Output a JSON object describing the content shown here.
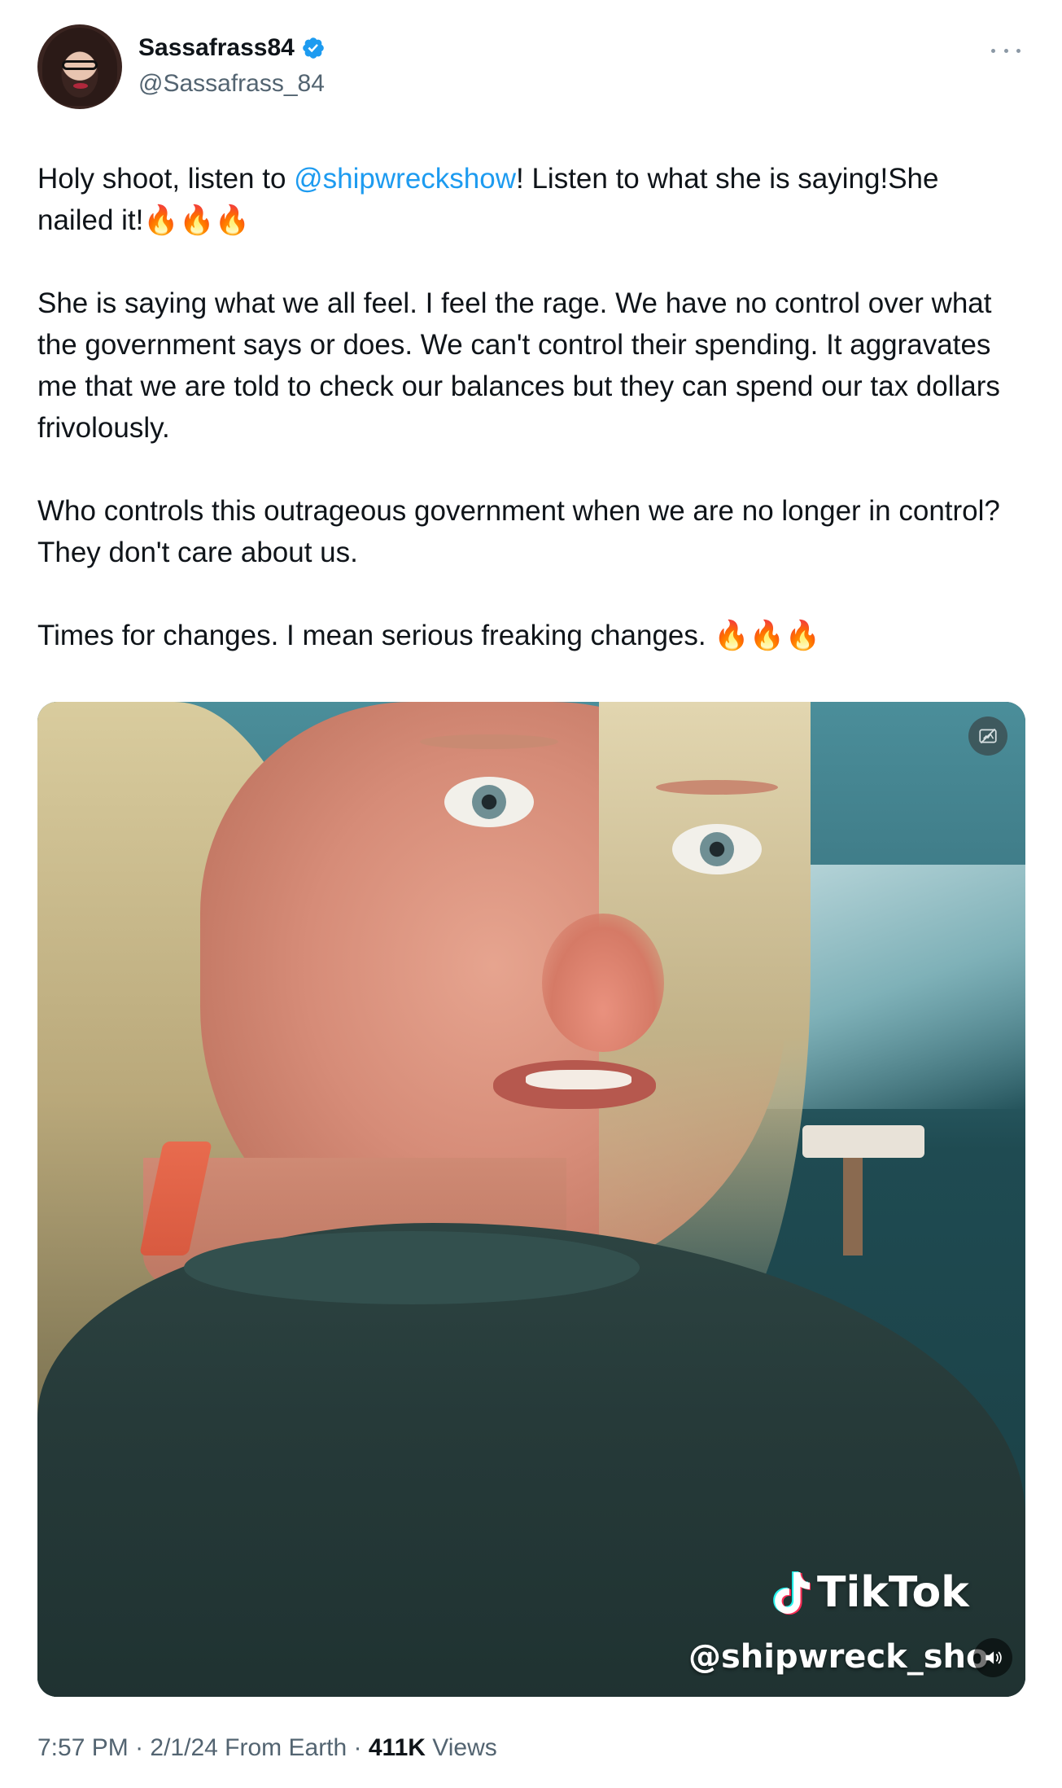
{
  "author": {
    "display_name": "Sassafrass84",
    "handle": "@Sassafrass_84",
    "verified": true
  },
  "tweet": {
    "paragraphs": [
      {
        "before": "Holy shoot, listen to ",
        "mention": "@shipwreckshow",
        "after": "! Listen to what she is saying!She nailed it!🔥🔥🔥"
      },
      {
        "text": "She is saying what we all feel. I feel the rage. We have no control over what the government says or does. We can't control their spending. It aggravates me that we are told to check our balances but they can spend our tax dollars frivolously."
      },
      {
        "text": "Who controls this outrageous government when we are no longer in control? They don't care about us."
      },
      {
        "text": "Times for changes. I mean serious freaking changes. 🔥🔥🔥"
      }
    ]
  },
  "media": {
    "watermark_brand": "TikTok",
    "watermark_user": "@shipwreck_show",
    "icons": [
      "sensitive-content-icon",
      "tiktok-logo-icon",
      "volume-icon"
    ]
  },
  "meta": {
    "time": "7:57 PM",
    "date": "2/1/24",
    "source": "From Earth",
    "sep": " · ",
    "views_count": "411K",
    "views_label": "Views"
  },
  "colors": {
    "text": "#0f1419",
    "secondary": "#536471",
    "accent": "#1d9bf0"
  }
}
